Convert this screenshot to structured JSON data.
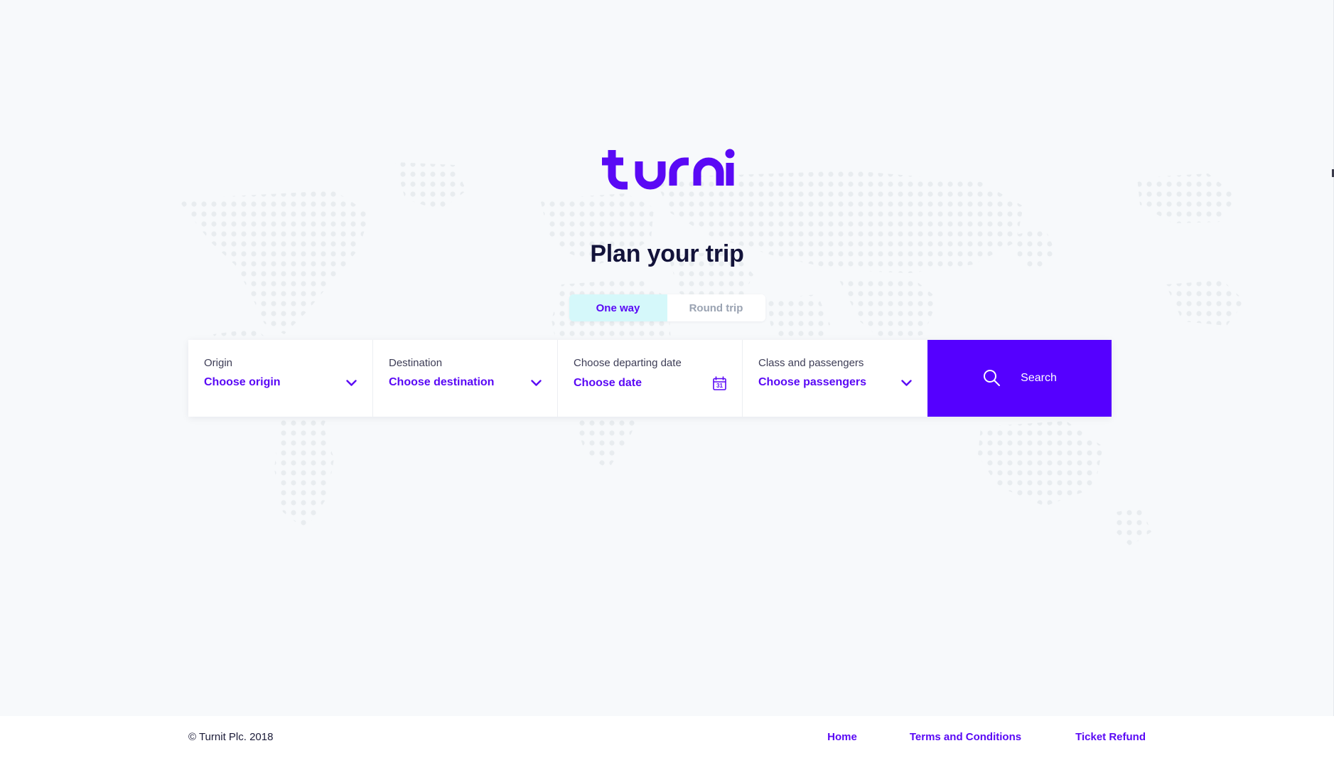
{
  "brand": {
    "logo_text": "turnit",
    "logo_color": "#5a09f5",
    "accent_color": "#5500ff",
    "tab_active_bg": "#d5f8fa",
    "heading_color": "#13133a",
    "page_bg": "#f7f9fb",
    "dot_color": "#e8ecef"
  },
  "hero": {
    "title": "Plan your trip"
  },
  "trip_type_tabs": [
    {
      "label": "One way",
      "active": true
    },
    {
      "label": "Round trip",
      "active": false
    }
  ],
  "search_form": {
    "fields": [
      {
        "label": "Origin",
        "value": "Choose origin",
        "icon": "chevron-down-icon",
        "name": "origin"
      },
      {
        "label": "Destination",
        "value": "Choose destination",
        "icon": "chevron-down-icon",
        "name": "destination"
      },
      {
        "label": "Choose departing date",
        "value": "Choose date",
        "icon": "calendar-icon",
        "icon_day": "31",
        "name": "departing-date"
      },
      {
        "label": "Class and passengers",
        "value": "Choose passengers",
        "icon": "chevron-down-icon",
        "name": "class-and-passengers"
      }
    ],
    "search_button": {
      "label": "Search",
      "icon": "search-icon"
    }
  },
  "footer": {
    "copyright": "© Turnit Plc. 2018",
    "links": [
      {
        "label": "Home"
      },
      {
        "label": "Terms and Conditions"
      },
      {
        "label": "Ticket Refund"
      }
    ]
  }
}
